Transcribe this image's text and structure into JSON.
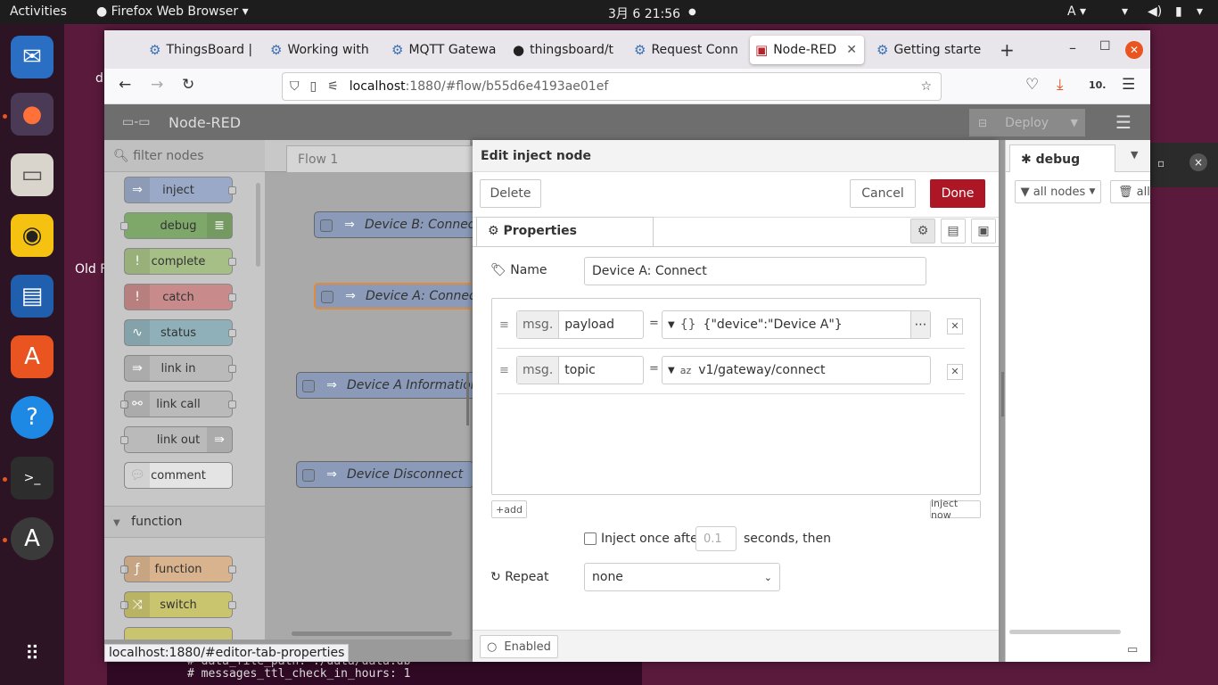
{
  "topbar": {
    "activities": "Activities",
    "app_name": "Firefox Web Browser",
    "clock": "3月 6  21:56",
    "input_method": "A"
  },
  "desktop": {
    "icon_label_1": "d",
    "icon_label_2": "Old F",
    "terminal_line_1": "#  data_file_path: ./data/data.db",
    "terminal_line_2": "#  messages_ttl_check_in_hours: 1"
  },
  "browser": {
    "tabs": [
      {
        "label": "ThingsBoard |"
      },
      {
        "label": "Working with"
      },
      {
        "label": "MQTT Gatewa"
      },
      {
        "label": "thingsboard/t"
      },
      {
        "label": "Request Conn"
      },
      {
        "label": "Node-RED"
      },
      {
        "label": "Getting starte"
      }
    ],
    "url_host": "localhost",
    "url_rest": ":1880/#flow/b55d6e4193ae01ef",
    "status_url": "localhost:1880/#editor-tab-properties",
    "ext_badge": "10."
  },
  "nodered": {
    "title": "Node-RED",
    "deploy_label": "Deploy",
    "filter_placeholder": "filter nodes",
    "flow_tab": "Flow 1",
    "palette": {
      "common": [
        {
          "label": "inject"
        },
        {
          "label": "debug"
        },
        {
          "label": "complete"
        },
        {
          "label": "catch"
        },
        {
          "label": "status"
        },
        {
          "label": "link in"
        },
        {
          "label": "link call"
        },
        {
          "label": "link out"
        },
        {
          "label": "comment"
        }
      ],
      "function_header": "function",
      "function": [
        {
          "label": "function"
        },
        {
          "label": "switch"
        }
      ]
    },
    "canvas_nodes": [
      {
        "label": "Device B: Connect"
      },
      {
        "label": "Device A: Connect"
      },
      {
        "label": "Device A Information"
      },
      {
        "label": "Device Disconnect"
      }
    ],
    "tray": {
      "title": "Edit inject node",
      "delete_label": "Delete",
      "cancel_label": "Cancel",
      "done_label": "Done",
      "tab_properties": "Properties",
      "name_label": "Name",
      "name_value": "Device A: Connect",
      "props": [
        {
          "prefix": "msg.",
          "key": "payload",
          "eq": "=",
          "type_icon": "{}",
          "value": "{\"device\":\"Device A\"}"
        },
        {
          "prefix": "msg.",
          "key": "topic",
          "eq": "=",
          "type_icon": "az",
          "value": "v1/gateway/connect"
        }
      ],
      "add_label": "add",
      "inject_now_label": "inject now",
      "inject_once_label": "Inject once after",
      "inject_once_value": "0.1",
      "seconds_label": "seconds, then",
      "repeat_label": "Repeat",
      "repeat_value": "none",
      "enabled_label": "Enabled"
    },
    "sidebar": {
      "tab_debug": "debug",
      "filter_label": "all nodes",
      "clear_label": "all"
    }
  }
}
